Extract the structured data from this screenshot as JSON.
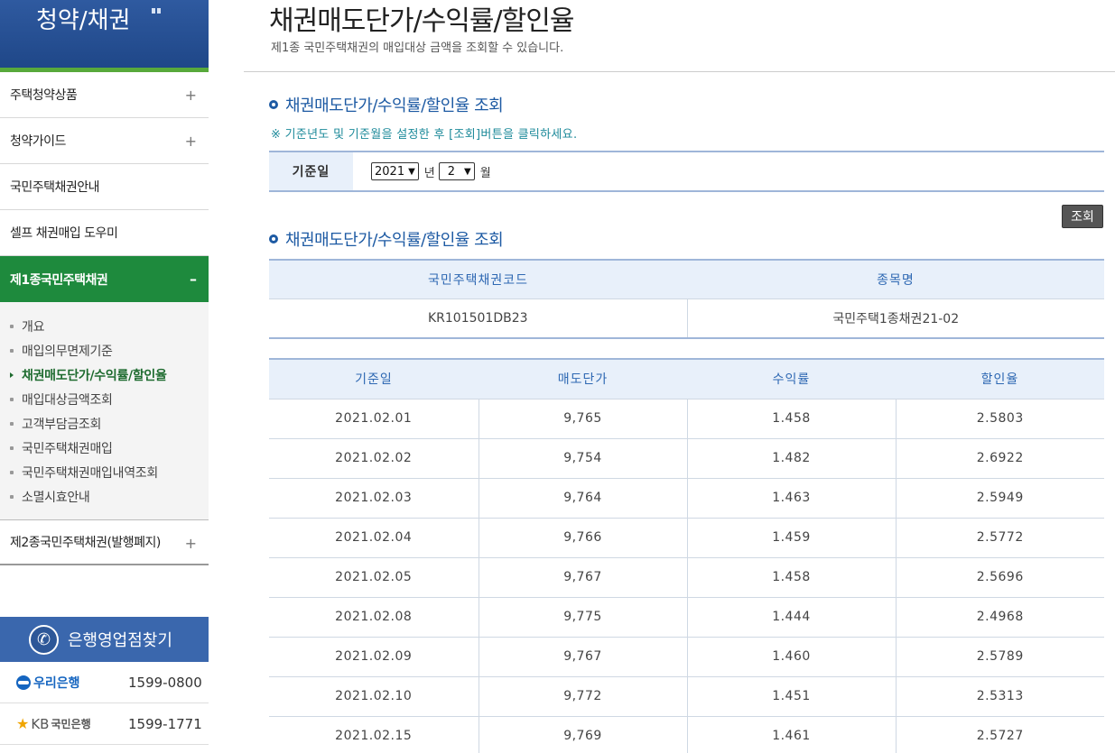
{
  "sidebar": {
    "title": "청약/채권",
    "menu": [
      {
        "label": "주택청약상품",
        "sign": "+"
      },
      {
        "label": "청약가이드",
        "sign": "+"
      },
      {
        "label": "국민주택채권안내",
        "sign": ""
      },
      {
        "label": "셀프 채권매입 도우미",
        "sign": ""
      },
      {
        "label": "제1종국민주택채권",
        "sign": "–"
      }
    ],
    "submenu": [
      "개요",
      "매입의무면제기준",
      "채권매도단가/수익률/할인율",
      "매입대상금액조회",
      "고객부담금조회",
      "국민주택채권매입",
      "국민주택채권매입내역조회",
      "소멸시효안내"
    ],
    "last_menu": {
      "label": "제2종국민주택채권(발행폐지)",
      "sign": "+"
    },
    "bank_finder": {
      "title": "은행영업점찾기",
      "banks": [
        {
          "name": "우리은행",
          "tel": "1599-0800"
        },
        {
          "name": "KB",
          "name2": "국민은행",
          "tel": "1599-1771"
        }
      ]
    }
  },
  "main": {
    "title": "채권매도단가/수익률/할인율",
    "description": "제1종 국민주택채권의 매입대상 금액을 조회할 수 있습니다.",
    "section1_title": "채권매도단가/수익률/할인율 조회",
    "notice": "※ 기준년도 및 기준월을 설정한 후 [조회]버튼을 클릭하세요.",
    "filter": {
      "label": "기준일",
      "year": "2021",
      "year_unit": "년",
      "month": "2",
      "month_unit": "월"
    },
    "search_button": "조회",
    "section2_title": "채권매도단가/수익률/할인율 조회",
    "bond_table": {
      "headers": [
        "국민주택채권코드",
        "종목명"
      ],
      "row": [
        "KR101501DB23",
        "국민주택1종채권21-02"
      ]
    },
    "rate_table": {
      "headers": [
        "기준일",
        "매도단가",
        "수익률",
        "할인율"
      ],
      "rows": [
        [
          "2021.02.01",
          "9,765",
          "1.458",
          "2.5803"
        ],
        [
          "2021.02.02",
          "9,754",
          "1.482",
          "2.6922"
        ],
        [
          "2021.02.03",
          "9,764",
          "1.463",
          "2.5949"
        ],
        [
          "2021.02.04",
          "9,766",
          "1.459",
          "2.5772"
        ],
        [
          "2021.02.05",
          "9,767",
          "1.458",
          "2.5696"
        ],
        [
          "2021.02.08",
          "9,775",
          "1.444",
          "2.4968"
        ],
        [
          "2021.02.09",
          "9,767",
          "1.460",
          "2.5789"
        ],
        [
          "2021.02.10",
          "9,772",
          "1.451",
          "2.5313"
        ],
        [
          "2021.02.15",
          "9,769",
          "1.461",
          "2.5727"
        ]
      ]
    }
  }
}
